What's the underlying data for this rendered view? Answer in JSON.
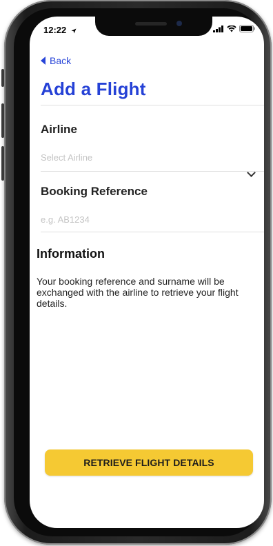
{
  "status_bar": {
    "time": "12:22",
    "location_icon": "location-arrow-icon",
    "signal_icon": "signal-bars-icon",
    "wifi_icon": "wifi-icon",
    "battery_icon": "battery-icon"
  },
  "nav": {
    "back_label": "Back",
    "back_icon": "back-chevron-icon"
  },
  "page": {
    "title": "Add a Flight"
  },
  "airline": {
    "label": "Airline",
    "placeholder": "Select Airline",
    "dropdown_icon": "chevron-down-icon"
  },
  "booking": {
    "label": "Booking Reference",
    "placeholder": "e.g. AB1234"
  },
  "information": {
    "heading": "Information",
    "text": "Your booking reference and surname will be exchanged with the airline to retrieve your flight details."
  },
  "actions": {
    "retrieve_label": "RETRIEVE FLIGHT DETAILS"
  },
  "colors": {
    "accent": "#2541d6",
    "button": "#f5c933",
    "placeholder": "#c4c4c4"
  }
}
